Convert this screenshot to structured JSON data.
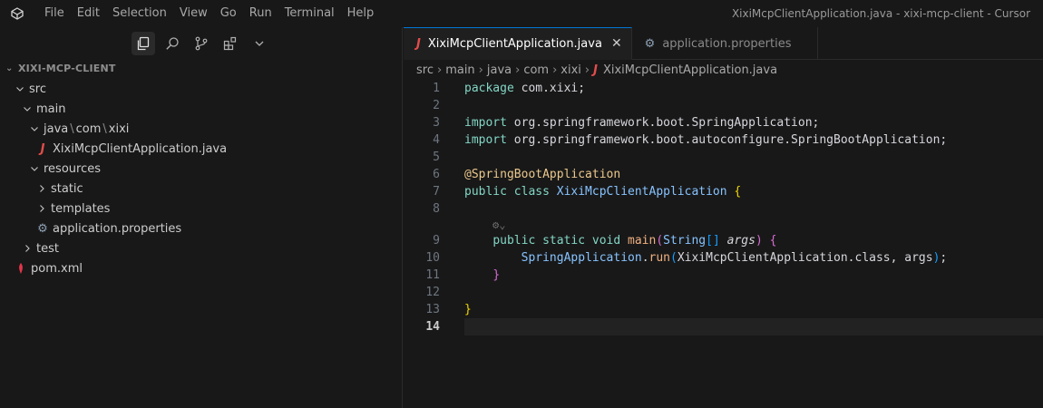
{
  "window": {
    "title": "XixiMcpClientApplication.java - xixi-mcp-client - Cursor"
  },
  "menu": [
    "File",
    "Edit",
    "Selection",
    "View",
    "Go",
    "Run",
    "Terminal",
    "Help"
  ],
  "sidebar": {
    "activity_icons": [
      "explorer-icon",
      "search-icon",
      "source-control-icon",
      "extensions-icon",
      "chevron-down-icon"
    ],
    "explorer_title": "XIXI-MCP-CLIENT",
    "tree": {
      "src": "src",
      "main": "main",
      "java": "java",
      "com": "com",
      "xixi": "xixi",
      "java_file": "XixiMcpClientApplication.java",
      "resources": "resources",
      "static": "static",
      "templates": "templates",
      "properties": "application.properties",
      "test": "test",
      "pom": "pom.xml"
    }
  },
  "tabs": [
    {
      "label": "XixiMcpClientApplication.java",
      "active": true
    },
    {
      "label": "application.properties",
      "active": false
    }
  ],
  "breadcrumb": [
    "src",
    "main",
    "java",
    "com",
    "xixi",
    "XixiMcpClientApplication.java"
  ],
  "code": {
    "line_numbers": [
      "1",
      "2",
      "3",
      "4",
      "5",
      "6",
      "7",
      "8",
      "9",
      "10",
      "11",
      "12",
      "13",
      "14"
    ],
    "l1_kw": "package",
    "l1_rest": " com.xixi;",
    "l3_kw": "import",
    "l3_rest": " org.springframework.boot.SpringApplication;",
    "l4_kw": "import",
    "l4_rest": " org.springframework.boot.autoconfigure.SpringBootApplication;",
    "l6_ann": "@SpringBootApplication",
    "l7_kw": "public class",
    "l7_cls": "XixiMcpClientApplication",
    "l7_brace": "{",
    "l9_kw": "public static void",
    "l9_fn": "main",
    "l9_p1": "(",
    "l9_type": "String",
    "l9_arr": "[]",
    "l9_param": "args",
    "l9_p2": ")",
    "l9_brace": "{",
    "l10_cls": "SpringApplication",
    "l10_dot": ".",
    "l10_fn": "run",
    "l10_p1": "(",
    "l10_arg": "XixiMcpClientApplication.class, args",
    "l10_p2": ")",
    "l10_end": ";",
    "l11_brace": "}",
    "l13_brace": "}"
  },
  "colors": {
    "accent": "#0078d4",
    "java_icon": "#e24c4b",
    "keyword": "#83d6c5",
    "class": "#87c3ff",
    "annotation": "#ebc88d",
    "function": "#efb080"
  }
}
